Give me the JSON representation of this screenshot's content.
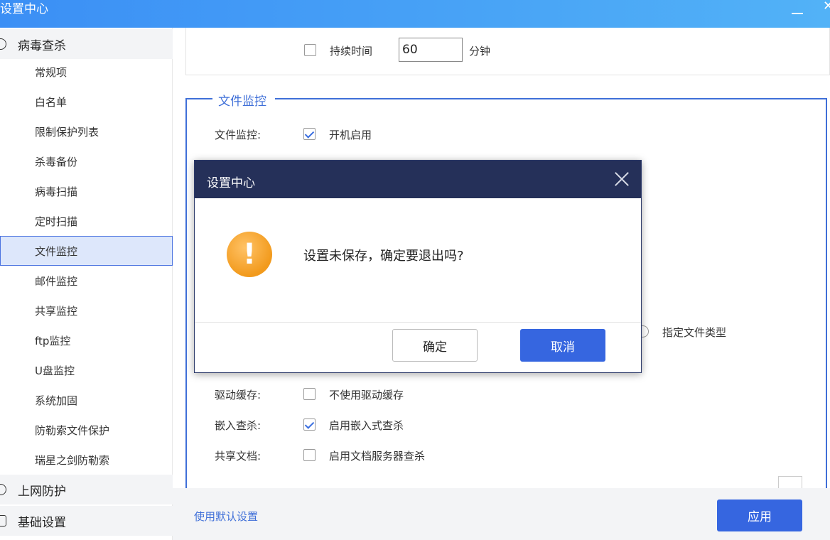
{
  "window": {
    "title": "设置中心"
  },
  "sidebar": {
    "groups": [
      {
        "label": "病毒查杀"
      },
      {
        "label": "上网防护"
      },
      {
        "label": "基础设置"
      }
    ],
    "items": [
      {
        "label": "常规项"
      },
      {
        "label": "白名单"
      },
      {
        "label": "限制保护列表"
      },
      {
        "label": "杀毒备份"
      },
      {
        "label": "病毒扫描"
      },
      {
        "label": "定时扫描"
      },
      {
        "label": "文件监控"
      },
      {
        "label": "邮件监控"
      },
      {
        "label": "共享监控"
      },
      {
        "label": "ftp监控"
      },
      {
        "label": "U盘监控"
      },
      {
        "label": "系统加固"
      },
      {
        "label": "防勒索文件保护"
      },
      {
        "label": "瑞星之剑防勒索"
      }
    ],
    "active_item": "文件监控"
  },
  "content": {
    "duration": {
      "label": "持续时间",
      "value": "60",
      "unit": "分钟"
    },
    "section_title": "文件监控",
    "rows": {
      "file_monitor": {
        "label": "文件监控:",
        "option": "开机启用"
      },
      "file_type": {
        "option": "指定文件类型"
      },
      "driver_cache": {
        "label": "驱动缓存:",
        "option": "不使用驱动缓存"
      },
      "embed_scan": {
        "label": "嵌入查杀:",
        "option": "启用嵌入式查杀"
      },
      "shared_docs": {
        "label": "共享文档:",
        "option": "启用文档服务器查杀"
      }
    }
  },
  "footer": {
    "default_link": "使用默认设置",
    "apply_label": "应用"
  },
  "modal": {
    "title": "设置中心",
    "message": "设置未保存，确定要退出吗?",
    "ok_label": "确定",
    "cancel_label": "取消",
    "icon": "warning-icon",
    "icon_glyph": "!"
  },
  "colors": {
    "accent": "#3666e0",
    "titlebar": "#3b8ff5",
    "modal_header": "#253059",
    "warning": "#f29a1c"
  }
}
